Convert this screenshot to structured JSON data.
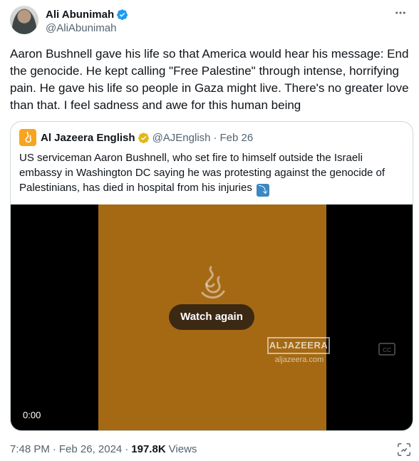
{
  "author": {
    "name": "Ali Abunimah",
    "handle": "@AliAbunimah"
  },
  "tweet": {
    "text": "Aaron Bushnell gave his life so that America would hear his message: End the genocide. He kept calling \"Free Palestine\" through intense, horrifying pain. He gave his life so people in Gaza might live. There's no greater love than that. I feel sadness and awe for this human being"
  },
  "quote": {
    "name": "Al Jazeera English",
    "handle": "@AJEnglish",
    "dot": "·",
    "date": "Feb 26",
    "text": "US serviceman Aaron Bushnell, who set fire to himself outside the Israeli embassy in Washington DC saying he was protesting against the genocide of Palestinians, has died in hospital from his injuries",
    "video": {
      "watermark_word": "ALJAZEERA",
      "watermark_domain": "aljazeera.com",
      "button_label": "Watch again",
      "time": "0:00"
    }
  },
  "meta": {
    "time": "7:48 PM",
    "dot1": "·",
    "date": "Feb 26, 2024",
    "dot2": "·",
    "views_count": "197.8K",
    "views_label": "Views"
  },
  "colors": {
    "verified_blue": "#1d9bf0",
    "business_gold": "#e2b719",
    "video_orange": "#a56914"
  }
}
